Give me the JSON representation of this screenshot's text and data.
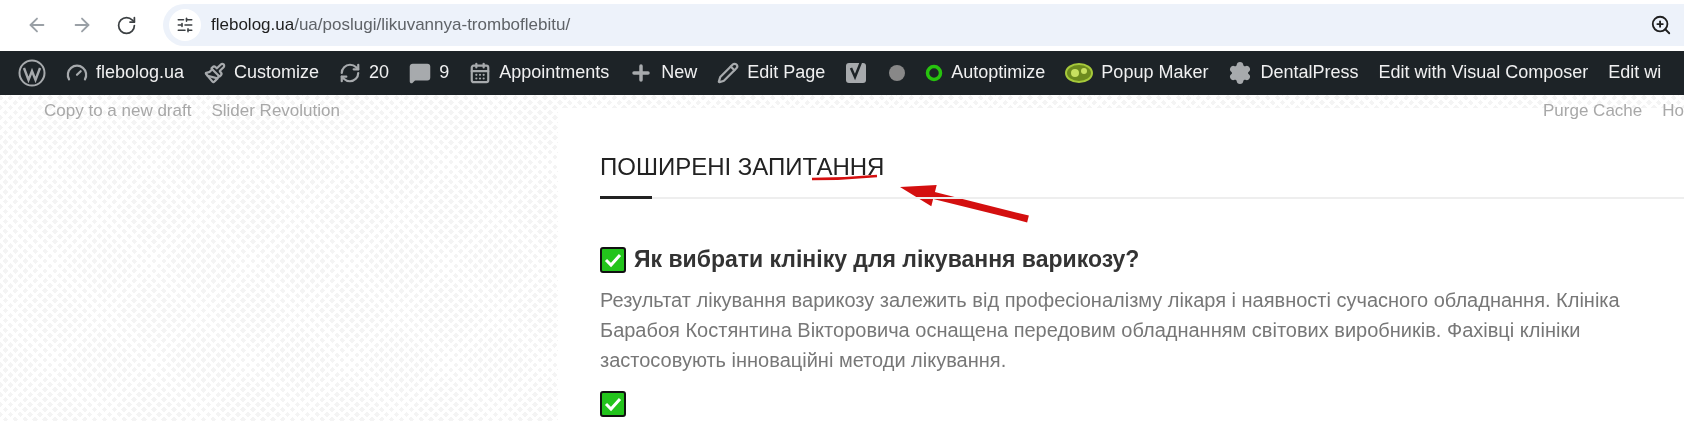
{
  "browser": {
    "url_host": "flebolog.ua",
    "url_path": "/ua/poslugi/likuvannya-tromboflebitu/"
  },
  "admin_bar": [
    {
      "kind": "logo"
    },
    {
      "kind": "site",
      "label": "flebolog.ua"
    },
    {
      "kind": "customize",
      "label": "Customize"
    },
    {
      "kind": "updates",
      "label": "20"
    },
    {
      "kind": "comments",
      "label": "9"
    },
    {
      "kind": "calendar",
      "label": "Appointments"
    },
    {
      "kind": "new",
      "label": "New"
    },
    {
      "kind": "edit",
      "label": "Edit Page"
    },
    {
      "kind": "seo"
    },
    {
      "kind": "dot"
    },
    {
      "kind": "optimize",
      "label": "Autoptimize"
    },
    {
      "kind": "popup",
      "label": "Popup Maker"
    },
    {
      "kind": "gear",
      "label": "DentalPress"
    },
    {
      "kind": "text",
      "label": "Edit with Visual Composer"
    },
    {
      "kind": "text",
      "label": "Edit wi"
    }
  ],
  "sub_bar": {
    "left": [
      "Copy to a new draft",
      "Slider Revolution"
    ],
    "right": [
      "Purge Cache",
      "Ho"
    ]
  },
  "section": {
    "title": "ПОШИРЕНІ ЗАПИТАННЯ"
  },
  "faq": [
    {
      "question": "Як вибрати клініку для лікування варикозу?",
      "answer": "Результат лікування варикозу залежить від професіоналізму лікаря і наявності сучасного обладнання. Клініка Барабоя Костянтина Вікторовича оснащена передовим обладнанням світових виробників. Фахівці клініки застосовують інноваційні методи лікування."
    }
  ]
}
